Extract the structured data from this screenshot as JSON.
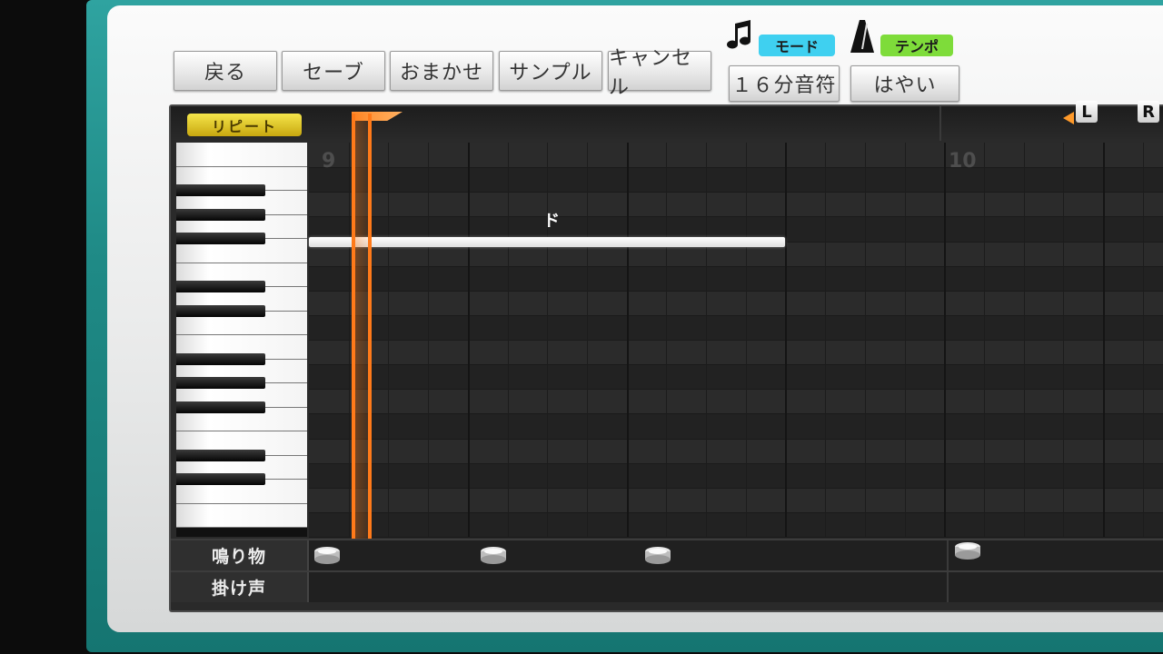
{
  "toolbar": {
    "back": "戻る",
    "save": "セーブ",
    "auto": "おまかせ",
    "sample": "サンプル",
    "cancel": "キャンセル"
  },
  "mode": {
    "tag": "モード",
    "value": "１６分音符",
    "icon": "music-note-icon",
    "tag_color": "#3fd0f0"
  },
  "tempo": {
    "tag": "テンポ",
    "value": "はやい",
    "icon": "metronome-icon",
    "tag_color": "#7edc3a"
  },
  "editor": {
    "repeat_label": "リピート",
    "bar_numbers": [
      "9",
      "10"
    ],
    "note_label": "ド",
    "loop_left": "L",
    "loop_right": "R",
    "accent_color": "#ff7a1a"
  },
  "tracks": {
    "percussion_label": "鳴り物",
    "voice_label": "掛け声"
  }
}
